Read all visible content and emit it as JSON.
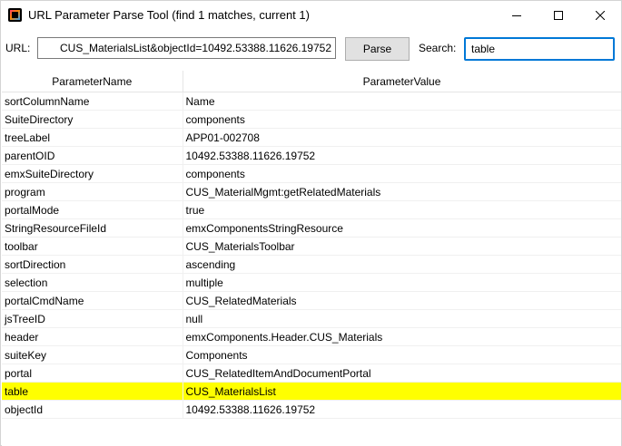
{
  "window": {
    "title": "URL Parameter Parse Tool (find 1 matches, current 1)"
  },
  "toolbar": {
    "url_label": "URL:",
    "url_value": "CUS_MaterialsList&objectId=10492.53388.11626.19752",
    "parse_label": "Parse",
    "search_label": "Search:",
    "search_value": "table"
  },
  "table": {
    "headers": [
      "ParameterName",
      "ParameterValue"
    ],
    "highlight_color": "#ffff00",
    "rows": [
      {
        "name": "sortColumnName",
        "value": "Name"
      },
      {
        "name": "SuiteDirectory",
        "value": "components"
      },
      {
        "name": "treeLabel",
        "value": "APP01-002708"
      },
      {
        "name": "parentOID",
        "value": "10492.53388.11626.19752"
      },
      {
        "name": "emxSuiteDirectory",
        "value": "components"
      },
      {
        "name": "program",
        "value": "CUS_MaterialMgmt:getRelatedMaterials"
      },
      {
        "name": "portalMode",
        "value": "true"
      },
      {
        "name": "StringResourceFileId",
        "value": "emxComponentsStringResource"
      },
      {
        "name": "toolbar",
        "value": "CUS_MaterialsToolbar"
      },
      {
        "name": "sortDirection",
        "value": "ascending"
      },
      {
        "name": "selection",
        "value": "multiple"
      },
      {
        "name": "portalCmdName",
        "value": "CUS_RelatedMaterials"
      },
      {
        "name": "jsTreeID",
        "value": "null"
      },
      {
        "name": "header",
        "value": "emxComponents.Header.CUS_Materials"
      },
      {
        "name": "suiteKey",
        "value": "Components"
      },
      {
        "name": "portal",
        "value": "CUS_RelatedItemAndDocumentPortal"
      },
      {
        "name": "table",
        "value": "CUS_MaterialsList",
        "highlighted": true
      },
      {
        "name": "objectId",
        "value": "10492.53388.11626.19752"
      }
    ]
  }
}
